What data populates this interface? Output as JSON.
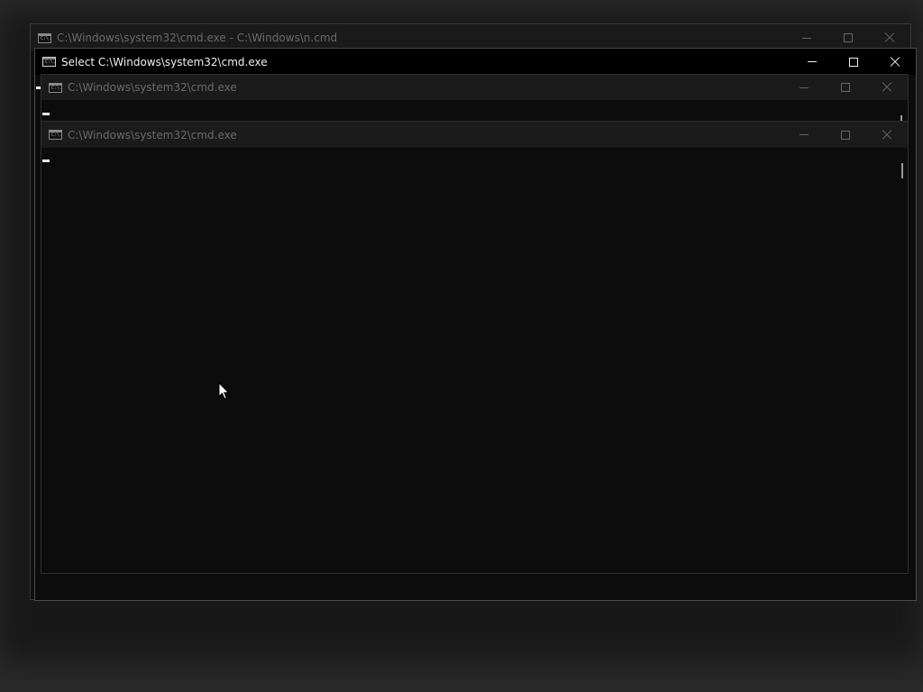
{
  "windows": {
    "back": {
      "title": "C:\\Windows\\system32\\cmd.exe - C:\\Windows\\n.cmd",
      "icon_glyph": "C:\\."
    },
    "active": {
      "title": "Select C:\\Windows\\system32\\cmd.exe",
      "icon_glyph": "C:\\."
    },
    "inner1": {
      "title": "C:\\Windows\\system32\\cmd.exe",
      "icon_glyph": "C:\\."
    },
    "inner2": {
      "title": "C:\\Windows\\system32\\cmd.exe",
      "icon_glyph": "C:\\."
    }
  },
  "icons": {
    "app": "cmd-icon",
    "minimize": "minimize-icon",
    "maximize": "maximize-icon",
    "close": "close-icon",
    "pointer": "mouse-pointer-icon"
  },
  "colors": {
    "desktop": "#282828",
    "console": "#0c0c0c",
    "title_active": "#f0f0f0",
    "title_inactive": "#6a6a6a"
  }
}
